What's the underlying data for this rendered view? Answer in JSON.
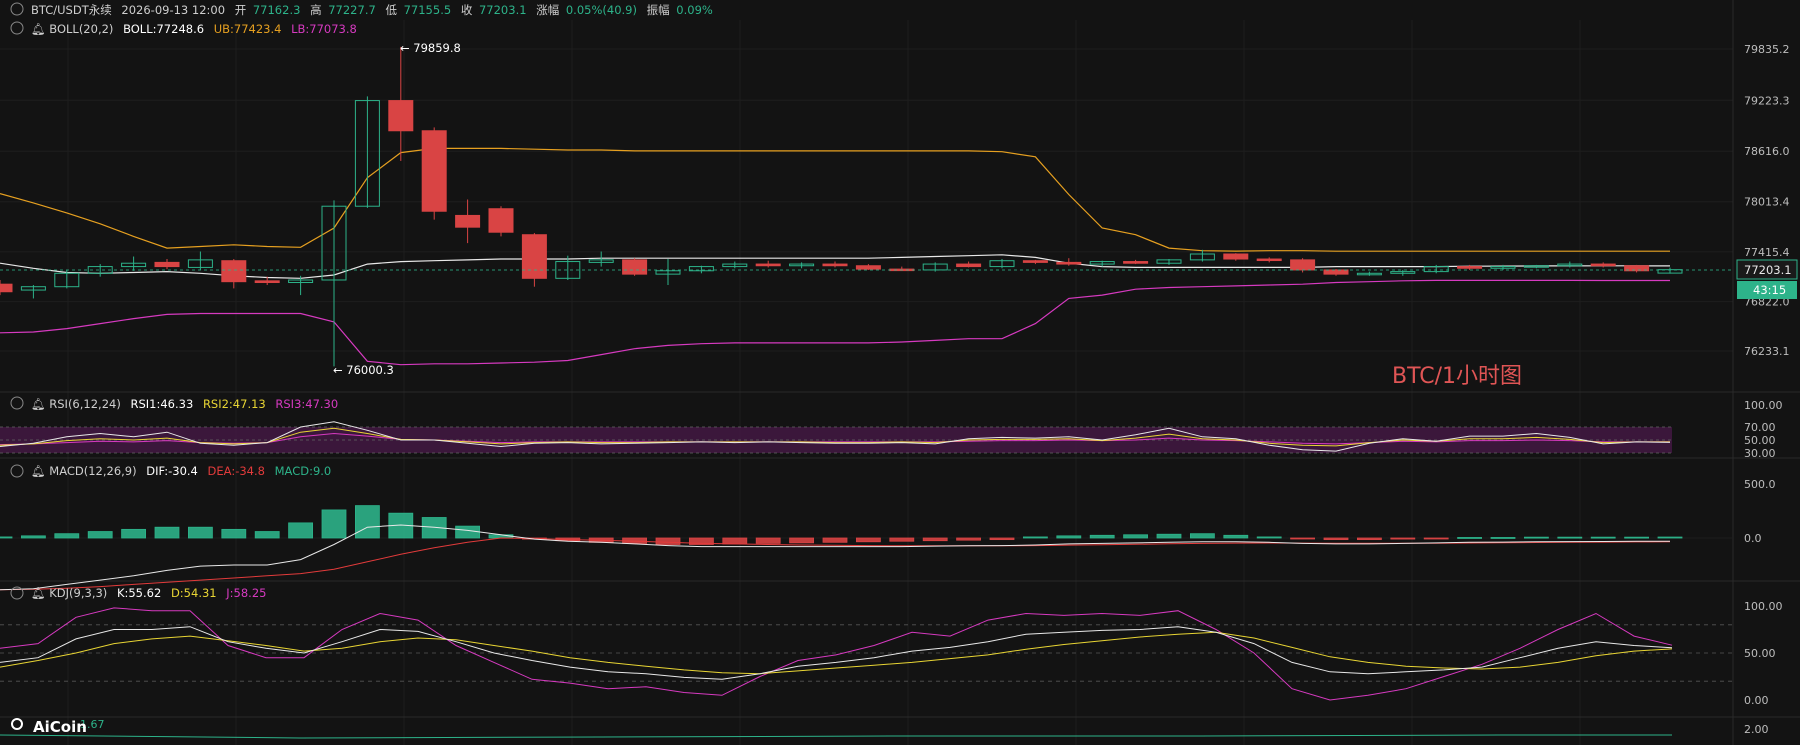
{
  "header": {
    "symbol": "BTC/USDT永续",
    "datetime": "2026-09-13 12:00",
    "open_label": "开",
    "open": "77162.3",
    "high_label": "高",
    "high": "77227.7",
    "low_label": "低",
    "low": "77155.5",
    "close_label": "收",
    "close": "77203.1",
    "change_label": "涨幅",
    "change": "0.05%(40.9)",
    "amp_label": "振幅",
    "amp": "0.09%"
  },
  "boll_legend": {
    "name": "BOLL(20,2)",
    "mid": "BOLL:77248.6",
    "ub": "UB:77423.4",
    "lb": "LB:77073.8"
  },
  "rsi_legend": {
    "name": "RSI(6,12,24)",
    "r1": "RSI1:46.33",
    "r2": "RSI2:47.13",
    "r3": "RSI3:47.30"
  },
  "macd_legend": {
    "name": "MACD(12,26,9)",
    "dif": "DIF:-30.4",
    "dea": "DEA:-34.8",
    "macd": "MACD:9.0"
  },
  "kdj_legend": {
    "name": "KDJ(9,3,3)",
    "k": "K:55.62",
    "d": "D:54.31",
    "j": "J:58.25"
  },
  "bottom_partial": "1.67",
  "watermark": "BTC/1小时图",
  "logo": "AiCoin",
  "current_price": "77203.1",
  "countdown": "43:15",
  "high_marker": "← 79859.8",
  "low_marker": "← 76000.3",
  "price_axis": [
    "79835.2",
    "79223.3",
    "78616.0",
    "78013.4",
    "77415.4",
    "76822.0",
    "76233.1"
  ],
  "rsi_axis": [
    "100.00",
    "70.00",
    "50.00",
    "30.00"
  ],
  "macd_axis": [
    "500.0",
    "0.0"
  ],
  "kdj_axis": [
    "100.00",
    "50.00",
    "0.00"
  ],
  "bottom_axis": [
    "2.00"
  ],
  "colors": {
    "up": "#2db38a",
    "down": "#d94444",
    "ub": "#e6a020",
    "lb": "#d63ac0",
    "mid": "#e8e8e8",
    "bg": "#131313"
  },
  "chart_data": [
    {
      "type": "candlestick",
      "title": "BTC/USDT永续 1小时",
      "ylim": [
        76000,
        80000
      ],
      "candles": [
        {
          "o": 77030,
          "h": 77080,
          "l": 76900,
          "c": 76940
        },
        {
          "o": 76960,
          "h": 77020,
          "l": 76860,
          "c": 77000
        },
        {
          "o": 77000,
          "h": 77200,
          "l": 76980,
          "c": 77160
        },
        {
          "o": 77160,
          "h": 77270,
          "l": 77120,
          "c": 77240
        },
        {
          "o": 77240,
          "h": 77360,
          "l": 77190,
          "c": 77280
        },
        {
          "o": 77290,
          "h": 77330,
          "l": 77210,
          "c": 77240
        },
        {
          "o": 77230,
          "h": 77420,
          "l": 77200,
          "c": 77320
        },
        {
          "o": 77310,
          "h": 77330,
          "l": 76980,
          "c": 77060
        },
        {
          "o": 77070,
          "h": 77120,
          "l": 77020,
          "c": 77050
        },
        {
          "o": 77050,
          "h": 77130,
          "l": 76900,
          "c": 77080
        },
        {
          "o": 77080,
          "h": 78030,
          "l": 76050,
          "c": 77960
        },
        {
          "o": 77960,
          "h": 79270,
          "l": 77940,
          "c": 79220
        },
        {
          "o": 79220,
          "h": 79860,
          "l": 78500,
          "c": 78860
        },
        {
          "o": 78860,
          "h": 78900,
          "l": 77800,
          "c": 77900
        },
        {
          "o": 77850,
          "h": 78040,
          "l": 77520,
          "c": 77710
        },
        {
          "o": 77930,
          "h": 77960,
          "l": 77600,
          "c": 77650
        },
        {
          "o": 77620,
          "h": 77640,
          "l": 77000,
          "c": 77100
        },
        {
          "o": 77100,
          "h": 77370,
          "l": 77080,
          "c": 77300
        },
        {
          "o": 77290,
          "h": 77420,
          "l": 77240,
          "c": 77320
        },
        {
          "o": 77320,
          "h": 77340,
          "l": 77130,
          "c": 77150
        },
        {
          "o": 77150,
          "h": 77330,
          "l": 77020,
          "c": 77190
        },
        {
          "o": 77190,
          "h": 77250,
          "l": 77160,
          "c": 77240
        },
        {
          "o": 77240,
          "h": 77300,
          "l": 77220,
          "c": 77270
        },
        {
          "o": 77270,
          "h": 77310,
          "l": 77230,
          "c": 77250
        },
        {
          "o": 77250,
          "h": 77290,
          "l": 77220,
          "c": 77270
        },
        {
          "o": 77270,
          "h": 77300,
          "l": 77230,
          "c": 77250
        },
        {
          "o": 77250,
          "h": 77270,
          "l": 77200,
          "c": 77210
        },
        {
          "o": 77210,
          "h": 77240,
          "l": 77190,
          "c": 77200
        },
        {
          "o": 77200,
          "h": 77290,
          "l": 77180,
          "c": 77270
        },
        {
          "o": 77270,
          "h": 77300,
          "l": 77230,
          "c": 77240
        },
        {
          "o": 77240,
          "h": 77330,
          "l": 77220,
          "c": 77310
        },
        {
          "o": 77310,
          "h": 77320,
          "l": 77270,
          "c": 77290
        },
        {
          "o": 77290,
          "h": 77340,
          "l": 77250,
          "c": 77270
        },
        {
          "o": 77270,
          "h": 77310,
          "l": 77240,
          "c": 77300
        },
        {
          "o": 77300,
          "h": 77320,
          "l": 77270,
          "c": 77280
        },
        {
          "o": 77280,
          "h": 77330,
          "l": 77260,
          "c": 77320
        },
        {
          "o": 77320,
          "h": 77440,
          "l": 77300,
          "c": 77390
        },
        {
          "o": 77390,
          "h": 77400,
          "l": 77310,
          "c": 77330
        },
        {
          "o": 77330,
          "h": 77350,
          "l": 77290,
          "c": 77320
        },
        {
          "o": 77320,
          "h": 77340,
          "l": 77170,
          "c": 77200
        },
        {
          "o": 77200,
          "h": 77210,
          "l": 77130,
          "c": 77150
        },
        {
          "o": 77150,
          "h": 77180,
          "l": 77130,
          "c": 77160
        },
        {
          "o": 77160,
          "h": 77200,
          "l": 77130,
          "c": 77180
        },
        {
          "o": 77180,
          "h": 77260,
          "l": 77160,
          "c": 77240
        },
        {
          "o": 77240,
          "h": 77260,
          "l": 77200,
          "c": 77220
        },
        {
          "o": 77220,
          "h": 77260,
          "l": 77200,
          "c": 77240
        },
        {
          "o": 77240,
          "h": 77260,
          "l": 77220,
          "c": 77250
        },
        {
          "o": 77250,
          "h": 77300,
          "l": 77230,
          "c": 77270
        },
        {
          "o": 77270,
          "h": 77290,
          "l": 77230,
          "c": 77250
        },
        {
          "o": 77250,
          "h": 77260,
          "l": 77170,
          "c": 77190
        },
        {
          "o": 77162.3,
          "h": 77227.7,
          "l": 77155.5,
          "c": 77203.1
        }
      ],
      "boll_ub": [
        78110,
        78000,
        77880,
        77750,
        77600,
        77460,
        77480,
        77500,
        77480,
        77470,
        77700,
        78300,
        78600,
        78650,
        78650,
        78650,
        78640,
        78630,
        78630,
        78620,
        78620,
        78620,
        78620,
        78620,
        78620,
        78620,
        78620,
        78620,
        78620,
        78620,
        78610,
        78550,
        78100,
        77700,
        77620,
        77460,
        77430,
        77425,
        77430,
        77430,
        77424,
        77423,
        77423,
        77423,
        77423,
        77423,
        77423,
        77423,
        77423,
        77423,
        77423
      ],
      "boll_mid": [
        77280,
        77220,
        77170,
        77160,
        77170,
        77180,
        77160,
        77130,
        77110,
        77100,
        77140,
        77270,
        77300,
        77310,
        77320,
        77330,
        77330,
        77330,
        77340,
        77340,
        77340,
        77340,
        77340,
        77340,
        77340,
        77340,
        77340,
        77350,
        77360,
        77370,
        77380,
        77350,
        77280,
        77240,
        77230,
        77230,
        77230,
        77230,
        77230,
        77230,
        77240,
        77240,
        77240,
        77240,
        77245,
        77246,
        77248,
        77248,
        77249,
        77249,
        77248.6
      ],
      "boll_lb": [
        76450,
        76460,
        76500,
        76560,
        76620,
        76670,
        76680,
        76680,
        76680,
        76680,
        76580,
        76110,
        76070,
        76080,
        76080,
        76090,
        76100,
        76120,
        76190,
        76260,
        76300,
        76320,
        76330,
        76330,
        76330,
        76330,
        76330,
        76340,
        76360,
        76380,
        76380,
        76560,
        76860,
        76900,
        76970,
        76990,
        77000,
        77010,
        77020,
        77030,
        77050,
        77060,
        77070,
        77075,
        77075,
        77075,
        77075,
        77075,
        77074,
        77074,
        77073.8
      ],
      "rsi1": [
        40,
        45,
        55,
        60,
        55,
        62,
        45,
        42,
        46,
        70,
        78,
        65,
        50,
        50,
        45,
        40,
        45,
        46,
        44,
        45,
        46,
        47,
        46,
        47,
        46,
        45,
        45,
        46,
        44,
        52,
        54,
        53,
        55,
        50,
        58,
        68,
        55,
        52,
        42,
        35,
        33,
        45,
        52,
        48,
        56,
        56,
        60,
        54,
        44,
        47,
        46.33
      ],
      "rsi2": [
        42,
        44,
        49,
        52,
        50,
        53,
        46,
        44,
        46,
        62,
        68,
        60,
        51,
        50,
        47,
        44,
        46,
        47,
        46,
        46,
        47,
        47,
        47,
        47,
        47,
        46,
        46,
        47,
        46,
        50,
        51,
        51,
        52,
        49,
        53,
        59,
        52,
        50,
        45,
        42,
        41,
        46,
        50,
        48,
        52,
        52,
        54,
        51,
        46,
        47,
        47.13
      ],
      "rsi3": [
        43,
        44,
        46,
        48,
        47,
        49,
        46,
        45,
        46,
        55,
        60,
        56,
        51,
        50,
        48,
        46,
        47,
        47,
        47,
        47,
        47,
        47,
        47,
        47,
        47,
        47,
        47,
        47,
        47,
        48,
        49,
        49,
        50,
        49,
        50,
        53,
        50,
        49,
        47,
        45,
        44,
        46,
        48,
        47,
        49,
        49,
        50,
        49,
        47,
        47,
        47.3
      ],
      "macd_dif": [
        -480,
        -470,
        -430,
        -390,
        -350,
        -300,
        -260,
        -250,
        -250,
        -200,
        -60,
        100,
        120,
        100,
        70,
        30,
        -10,
        -30,
        -40,
        -55,
        -70,
        -80,
        -80,
        -80,
        -80,
        -80,
        -80,
        -80,
        -75,
        -72,
        -70,
        -65,
        -55,
        -50,
        -45,
        -40,
        -35,
        -35,
        -40,
        -50,
        -55,
        -55,
        -50,
        -45,
        -40,
        -38,
        -35,
        -33,
        -32,
        -31,
        -30.4
      ],
      "macd_dea": [
        -480,
        -475,
        -465,
        -450,
        -430,
        -410,
        -390,
        -370,
        -350,
        -330,
        -290,
        -220,
        -150,
        -90,
        -40,
        0,
        -5,
        -15,
        -20,
        -30,
        -40,
        -50,
        -55,
        -60,
        -65,
        -68,
        -70,
        -72,
        -72,
        -72,
        -72,
        -70,
        -66,
        -62,
        -58,
        -54,
        -50,
        -47,
        -46,
        -47,
        -48,
        -49,
        -49,
        -48,
        -46,
        -44,
        -42,
        -40,
        -38,
        -36,
        -34.8
      ],
      "macd_hist": [
        10,
        20,
        40,
        60,
        80,
        100,
        100,
        80,
        60,
        140,
        260,
        300,
        230,
        190,
        110,
        30,
        -10,
        -25,
        -40,
        -50,
        -60,
        -60,
        -55,
        -50,
        -45,
        -40,
        -35,
        -30,
        -25,
        -20,
        -15,
        10,
        20,
        25,
        30,
        35,
        40,
        25,
        10,
        -5,
        -15,
        -15,
        -10,
        -5,
        5,
        5,
        8,
        8,
        8,
        8,
        9.0
      ],
      "kdj_k": [
        40,
        45,
        65,
        75,
        75,
        78,
        62,
        55,
        50,
        62,
        75,
        73,
        62,
        50,
        42,
        35,
        30,
        28,
        24,
        22,
        28,
        36,
        40,
        45,
        52,
        56,
        62,
        70,
        72,
        74,
        75,
        78,
        72,
        60,
        40,
        30,
        28,
        30,
        32,
        35,
        45,
        55,
        62,
        58,
        55.62
      ],
      "kdj_d": [
        35,
        42,
        50,
        60,
        65,
        68,
        63,
        58,
        52,
        55,
        62,
        66,
        64,
        58,
        52,
        45,
        40,
        36,
        32,
        29,
        28,
        31,
        34,
        37,
        40,
        44,
        48,
        54,
        59,
        63,
        67,
        70,
        72,
        66,
        56,
        46,
        40,
        36,
        34,
        33,
        35,
        40,
        47,
        52,
        54.31
      ],
      "kdj_j": [
        55,
        60,
        88,
        98,
        95,
        95,
        58,
        45,
        45,
        75,
        92,
        85,
        58,
        40,
        22,
        18,
        12,
        14,
        8,
        5,
        25,
        42,
        48,
        58,
        72,
        68,
        85,
        92,
        90,
        92,
        90,
        95,
        75,
        50,
        12,
        0,
        5,
        12,
        25,
        38,
        55,
        75,
        92,
        68,
        58.25
      ]
    }
  ]
}
